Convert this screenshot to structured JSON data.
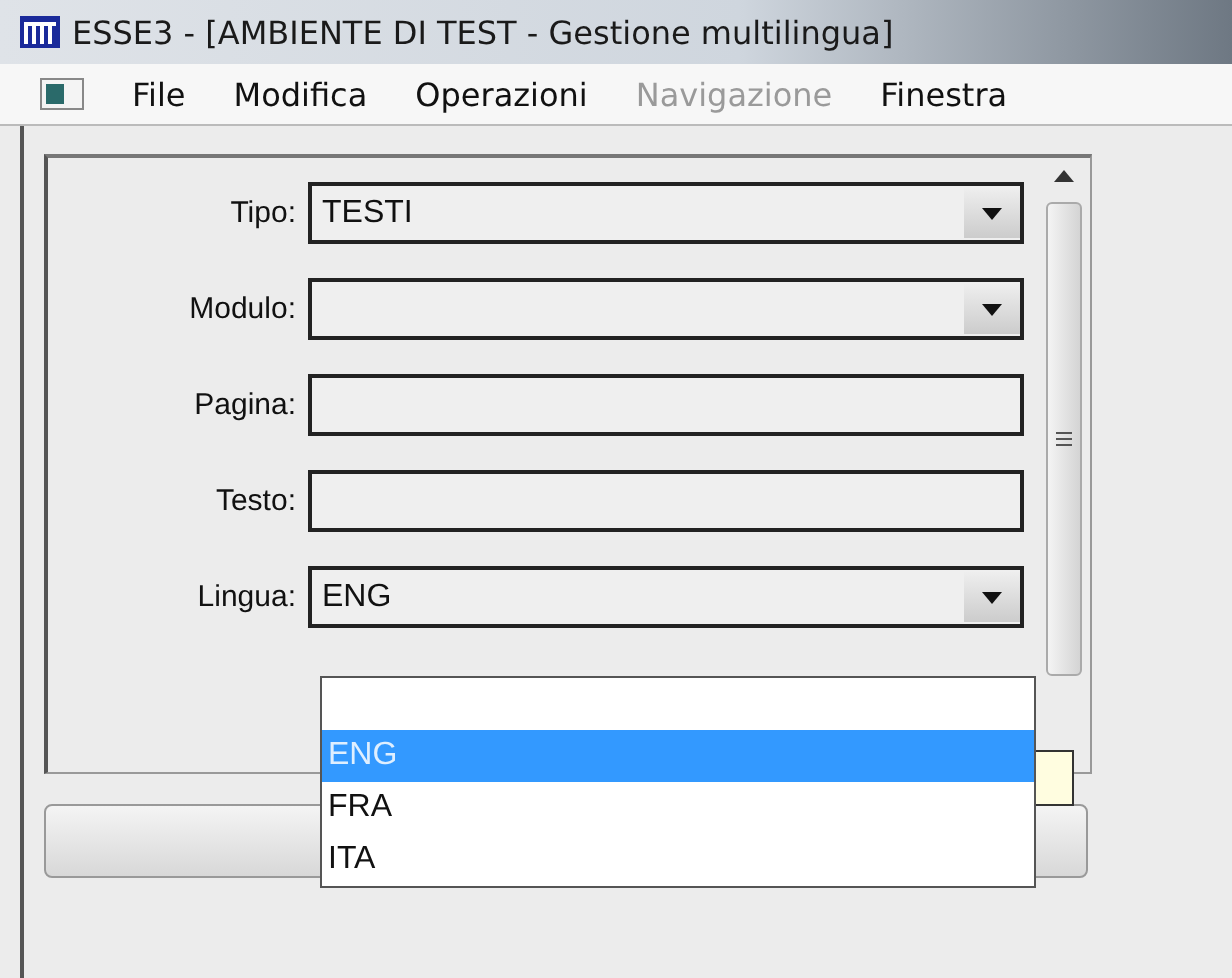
{
  "window": {
    "title": "ESSE3 - [AMBIENTE DI TEST - Gestione multilingua]"
  },
  "menu": [
    {
      "label": "File",
      "disabled": false
    },
    {
      "label": "Modifica",
      "disabled": false
    },
    {
      "label": "Operazioni",
      "disabled": false
    },
    {
      "label": "Navigazione",
      "disabled": true
    },
    {
      "label": "Finestra",
      "disabled": false
    }
  ],
  "form": [
    {
      "label": "Tipo:",
      "kind": "combo",
      "value": "TESTI"
    },
    {
      "label": "Modulo:",
      "kind": "combo"
    },
    {
      "label": "Pagina:",
      "kind": "text"
    },
    {
      "label": "Testo:",
      "kind": "text"
    },
    {
      "label": "Lingua:",
      "kind": "combo",
      "value": "ENG"
    }
  ],
  "dropdown": {
    "options": [
      {
        "label": "ENG",
        "selected": true
      },
      {
        "label": "FRA",
        "selected": false
      },
      {
        "label": "ITA",
        "selected": false
      }
    ]
  }
}
